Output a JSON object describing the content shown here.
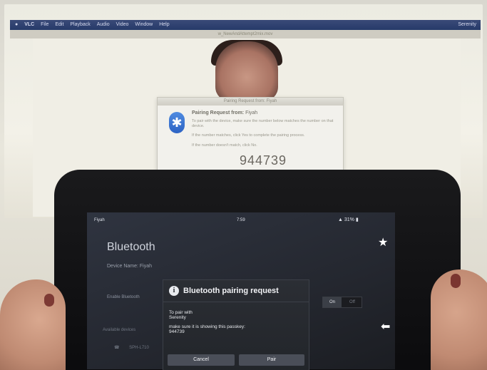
{
  "mac": {
    "menubar": {
      "apple": "",
      "items": [
        "VLC",
        "File",
        "Edit",
        "Playback",
        "Audio",
        "Video",
        "Window",
        "Help"
      ],
      "right": "Serenity"
    },
    "window_title": "w_NewAndAttempt2mix.mov",
    "pairing_dialog": {
      "titlebar": "Pairing Request from: Fiyah",
      "heading": "Pairing Request from:",
      "device": "Fiyah",
      "line1": "To pair with the device, make sure the number below matches the number on that device.",
      "line2": "If the number matches, click Yes to complete the pairing process.",
      "line3": "If the number doesn't match, click No.",
      "passkey": "944739"
    }
  },
  "tablet": {
    "status": {
      "device": "Fiyah",
      "time": "7:59",
      "battery": "31%"
    },
    "settings": {
      "title": "Bluetooth",
      "device_name": "Device Name: Fiyah",
      "enable": "Enable Bluetooth",
      "toggle_on": "On",
      "toggle_off": "Off",
      "available": "Available devices",
      "device_row": "SPH-L710"
    },
    "pair_dialog": {
      "title": "Bluetooth pairing request",
      "line1": "To pair with",
      "device": "Serenity",
      "line2": "make sure it is showing this passkey:",
      "passkey": "944739",
      "cancel": "Cancel",
      "pair": "Pair"
    }
  }
}
